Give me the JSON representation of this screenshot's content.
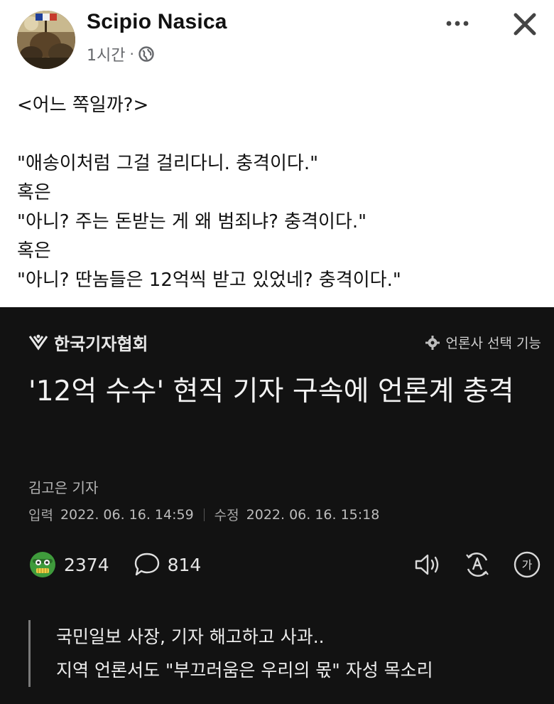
{
  "post": {
    "author": "Scipio Nasica",
    "time": "1시간",
    "separator": "·",
    "lines": [
      "<어느 쪽일까?>",
      "",
      "\"애송이처럼 그걸 걸리다니. 충격이다.\"",
      "혹은",
      "\"아니? 주는 돈받는 게 왜 범죄냐? 충격이다.\"",
      "혹은",
      "\"아니? 딴놈들은 12억씩 받고 있었네? 충격이다.\""
    ]
  },
  "article": {
    "brand": "한국기자협회",
    "press_select": "언론사 선택 기능",
    "headline": "'12억 수수' 현직 기자 구속에 언론계 충격",
    "reporter": "김고은 기자",
    "input_label": "입력",
    "input_date": "2022. 06. 16. 14:59",
    "edit_label": "수정",
    "edit_date": "2022. 06. 16. 15:18",
    "reaction_count": "2374",
    "comment_count": "814",
    "font_icon_label": "가",
    "summary": [
      "국민일보 사장, 기자 해고하고 사과..",
      "지역 언론서도 \"부끄러움은 우리의 몫\" 자성 목소리"
    ]
  },
  "icons": {
    "globe": "globe-icon",
    "more": "more-icon",
    "close": "close-icon",
    "brand_logo": "brand-logo-icon",
    "gear": "gear-icon",
    "reaction": "reaction-emoji-icon",
    "comment": "comment-icon",
    "speaker": "speaker-icon",
    "translate": "translate-icon",
    "font_size": "font-size-icon"
  },
  "colors": {
    "article_bg": "#121212",
    "meta_gray": "#65676b",
    "emoji_green": "#3f9b3c"
  }
}
